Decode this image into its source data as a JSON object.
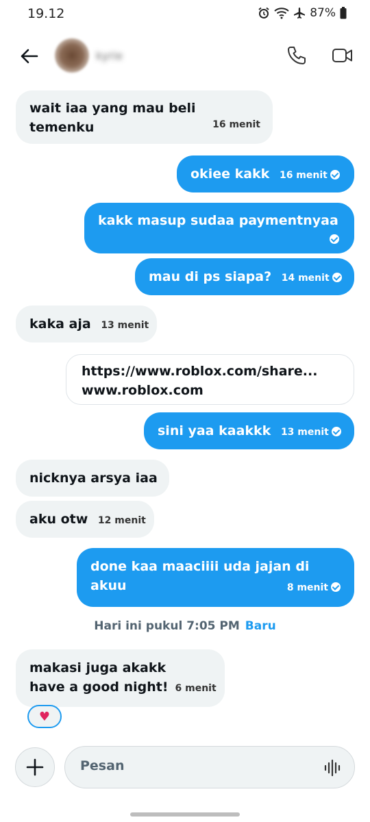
{
  "status": {
    "time": "19.12",
    "battery": "87%"
  },
  "header": {
    "contact_name": "kyrie"
  },
  "messages": [
    {
      "dir": "in",
      "text": "wait iaa yang mau beli temenku",
      "time": "16 menit"
    },
    {
      "dir": "out",
      "text": "okiee kakk",
      "time": "16 menit"
    },
    {
      "dir": "out",
      "text": "kakk masup sudaa paymentnyaa",
      "time": ""
    },
    {
      "dir": "out",
      "text": "mau di ps siapa?",
      "time": "14 menit"
    },
    {
      "dir": "in",
      "text": "kaka aja",
      "time": "13 menit"
    },
    {
      "dir": "out",
      "text": "sini yaa kaakkk",
      "time": "13 menit"
    },
    {
      "dir": "in",
      "text": "nicknya arsya iaa",
      "time": ""
    },
    {
      "dir": "in",
      "text": "aku otw",
      "time": "12 menit"
    },
    {
      "dir": "out",
      "text": "done kaa maaciiii uda jajan di akuu",
      "time": "8 menit"
    },
    {
      "dir": "in",
      "text": "makasi juga akakk",
      "text2": "have a good night!",
      "time": "6 menit"
    }
  ],
  "link_card": {
    "url": "https://www.roblox.com/share...",
    "domain": "www.roblox.com"
  },
  "divider": {
    "text": "Hari ini pukul 7:05 PM",
    "badge": "Baru"
  },
  "reaction": {
    "emoji": "♥"
  },
  "composer": {
    "placeholder": "Pesan"
  }
}
